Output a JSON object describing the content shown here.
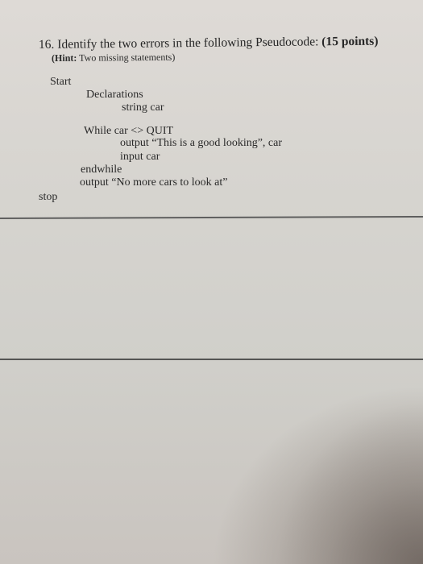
{
  "question": {
    "number": "16.",
    "prompt": "Identify the two errors in the following Pseudocode:",
    "points": "(15 points)",
    "hint_label": "(Hint:",
    "hint_text": "Two missing statements)"
  },
  "pseudocode": {
    "start": "Start",
    "declarations": "Declarations",
    "declaration_var": "string car",
    "while_keyword": "While car",
    "while_operator": "<>",
    "while_value": "QUIT",
    "loop_output": "output “This is a good looking”, car",
    "loop_input": "input car",
    "endwhile": "endwhile",
    "final_output": "output “No more cars to look at”",
    "stop": "stop"
  }
}
